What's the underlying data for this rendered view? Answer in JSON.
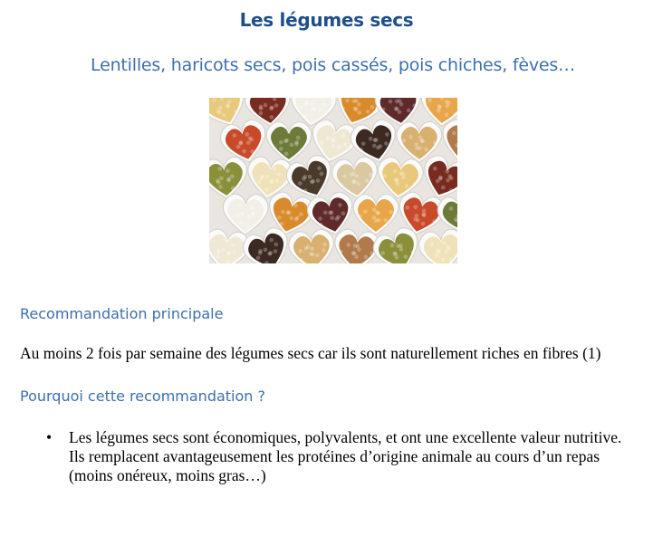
{
  "document": {
    "title": "Les légumes secs",
    "subtitle": "Lentilles, haricots secs, pois cassés, pois chiches, fèves…",
    "sections": [
      {
        "heading": "Recommandation principale",
        "text": "Au moins 2 fois par semaine des légumes secs car ils sont naturellement riches en fibres (1)"
      },
      {
        "heading": "Pourquoi cette recommandation ?",
        "bullets": [
          "Les légumes secs sont économiques, polyvalents, et ont une excellente valeur nutritive. Ils remplacent avantageusement les protéines d’origine animale au cours d’un repas (moins onéreux, moins gras…)"
        ]
      }
    ],
    "bullet_symbol": "•"
  }
}
